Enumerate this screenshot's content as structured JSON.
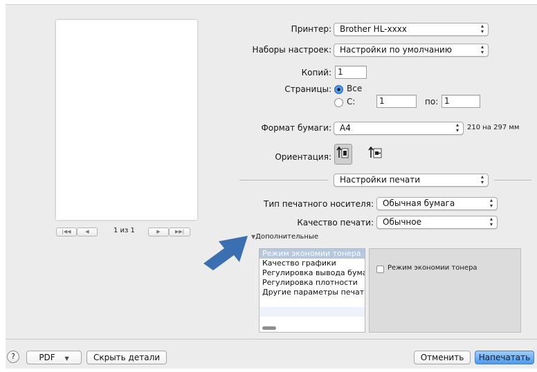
{
  "printer": {
    "label": "Принтер:",
    "value": "Brother HL-xxxx"
  },
  "presets": {
    "label": "Наборы настроек:",
    "value": "Настройки по умолчанию"
  },
  "copies": {
    "label": "Копий:",
    "value": "1"
  },
  "pages": {
    "label": "Страницы:",
    "all_label": "Все",
    "from_label": "С:",
    "from_value": "1",
    "to_label": "по:",
    "to_value": "1",
    "selected": "all"
  },
  "paper_size": {
    "label": "Формат бумаги:",
    "value": "A4",
    "dimensions": "210 на 297 мм"
  },
  "orientation": {
    "label": "Ориентация:"
  },
  "section": {
    "value": "Настройки печати"
  },
  "media_type": {
    "label": "Тип печатного носителя:",
    "value": "Обычная бумага"
  },
  "print_quality": {
    "label": "Качество печати:",
    "value": "Обычное"
  },
  "preview": {
    "page_indicator": "1 из 1"
  },
  "advanced": {
    "disclosure_label": "Дополнительные",
    "items": [
      "Режим экономии тонера",
      "Качество графики",
      "Регулировка вывода бумаги",
      "Регулировка плотности",
      "Другие параметры печати"
    ],
    "selected_index": 0,
    "toner_save_checkbox_label": "Режим экономии тонера",
    "toner_save_checked": false
  },
  "footer": {
    "help_label": "?",
    "pdf_label": "PDF",
    "hide_details_label": "Скрыть детали",
    "cancel_label": "Отменить",
    "print_label": "Напечатать"
  },
  "colors": {
    "arrow": "#3a6fb2",
    "selection": "#b6c7e0",
    "default_button": "#4a9bef"
  },
  "icons": [
    "portrait-orientation-icon",
    "landscape-orientation-icon",
    "first-page-icon",
    "previous-page-icon",
    "next-page-icon",
    "last-page-icon",
    "callout-arrow-icon",
    "popup-arrows-icon",
    "disclosure-triangle-icon"
  ]
}
